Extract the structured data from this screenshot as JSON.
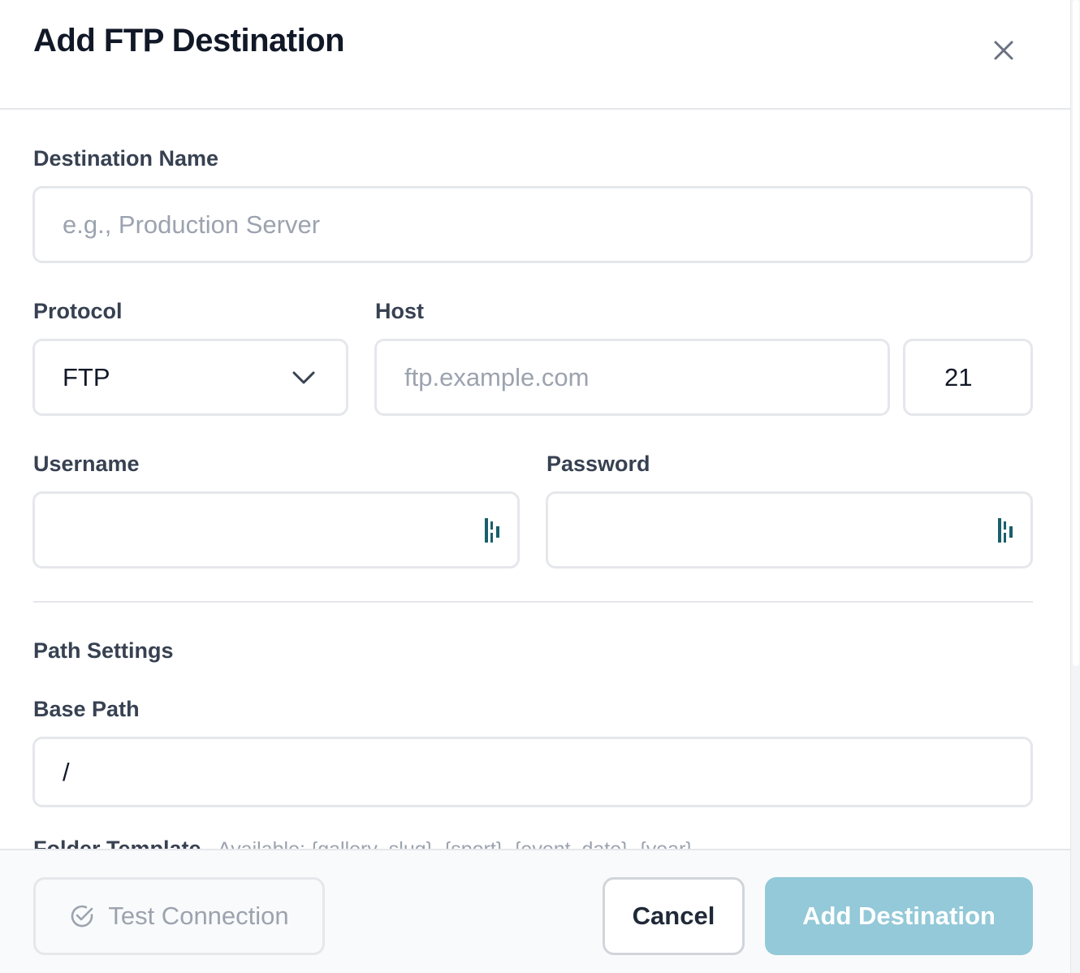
{
  "dialog": {
    "title": "Add FTP Destination"
  },
  "form": {
    "destination_name": {
      "label": "Destination Name",
      "value": "",
      "placeholder": "e.g., Production Server"
    },
    "protocol": {
      "label": "Protocol",
      "selected": "FTP"
    },
    "host": {
      "label": "Host",
      "value": "",
      "placeholder": "ftp.example.com"
    },
    "port": {
      "value": "21"
    },
    "username": {
      "label": "Username",
      "value": ""
    },
    "password": {
      "label": "Password",
      "value": ""
    }
  },
  "path_settings": {
    "section_title": "Path Settings",
    "base_path": {
      "label": "Base Path",
      "value": "/"
    },
    "folder_template": {
      "label": "Folder Template",
      "hint": "Available: {gallery_slug}, {sport}, {event_date}, {year}"
    }
  },
  "footer": {
    "test_connection_label": "Test Connection",
    "cancel_label": "Cancel",
    "add_label": "Add Destination"
  },
  "colors": {
    "primary_disabled": "#93c9d8",
    "password_manager_icon": "#1b5e6b",
    "border": "#e5e7eb",
    "text_dark": "#111827",
    "placeholder": "#9ca3af"
  },
  "icons": {
    "close": "close-icon",
    "chevron": "chevron-down-icon",
    "password_manager": "password-manager-icon",
    "test_connection": "check-circle-icon"
  }
}
